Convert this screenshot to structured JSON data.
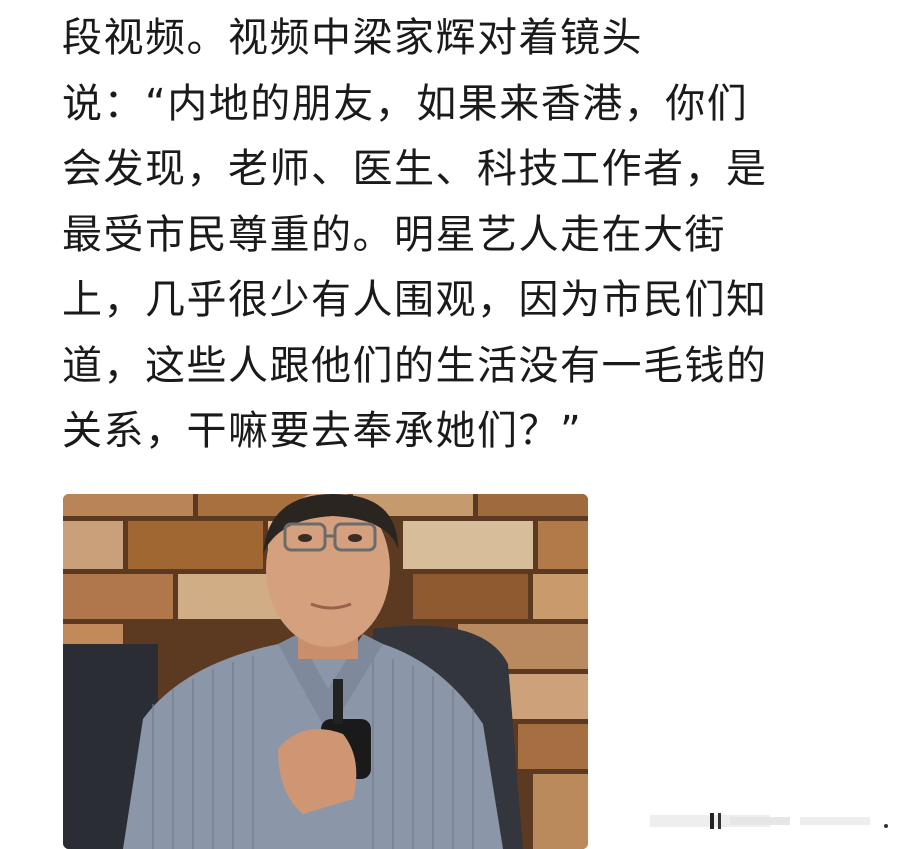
{
  "article": {
    "lines": [
      "段视频。视频中梁家辉对着镜头",
      "说：“内地的朋友，如果来香港，你们",
      "会发现，老师、医生、科技工作者，是",
      "最受市民尊重的。明星艺人走在大街",
      "上，几乎很少有人围观，因为市民们知",
      "道，这些人跟他们的生活没有一毛钱的",
      "关系，干嘛要去奉承她们？”"
    ]
  },
  "photo": {
    "subject": "man in striped shirt holding microphone, seated in front of brick wall"
  },
  "colors": {
    "text": "#1a1a1a",
    "background": "#ffffff",
    "brick": "#b07a4e",
    "shirt": "#8b96a8",
    "chair": "#2a2d33"
  }
}
